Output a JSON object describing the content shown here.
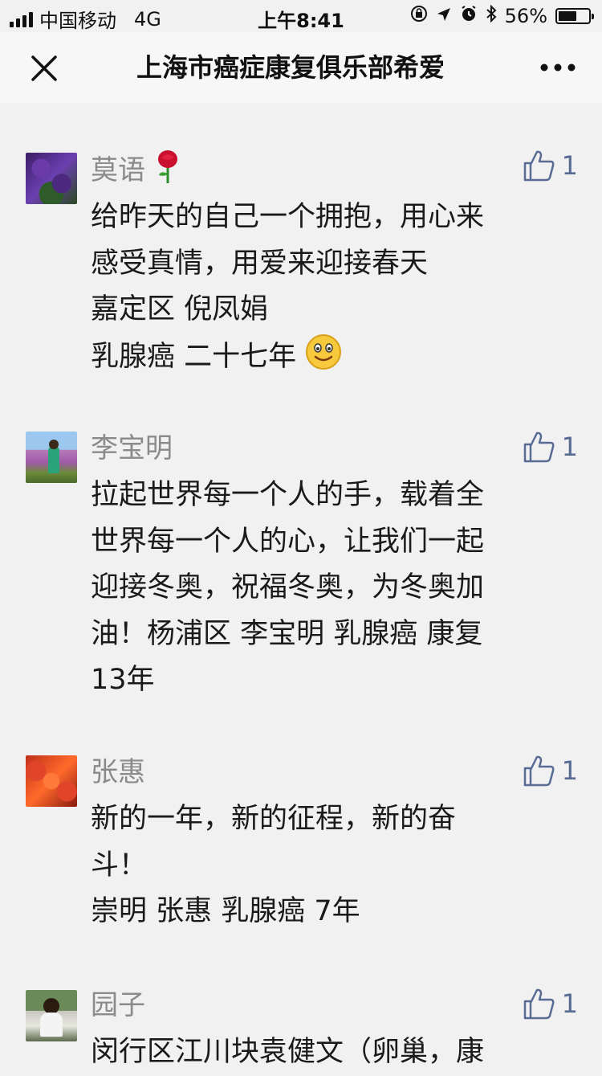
{
  "status_bar": {
    "carrier": "中国移动",
    "network": "4G",
    "time": "上午8:41",
    "battery": "56%",
    "battery_level": 0.56
  },
  "navbar": {
    "title": "上海市癌症康复俱乐部希爱",
    "close_icon": "close-icon",
    "more_icon": "more-dots-icon"
  },
  "comments": [
    {
      "name": "莫语",
      "likes": "1",
      "lines": [
        "给昨天的自己一个拥抱，用心来",
        "感受真情，用爱来迎接春天",
        "嘉定区  倪凤娟",
        "乳腺癌  二十七年"
      ]
    },
    {
      "name": "李宝明",
      "likes": "1",
      "lines": [
        "拉起世界每一个人的手，载着全",
        "世界每一个人的心，让我们一起",
        "迎接冬奥，祝福冬奥，为冬奥加",
        "油！杨浦区 李宝明 乳腺癌 康复",
        "13年"
      ]
    },
    {
      "name": "张惠",
      "likes": "1",
      "lines": [
        "新的一年，新的征程，新的奋",
        "斗！",
        "崇明 张惠  乳腺癌  7年"
      ]
    },
    {
      "name": "园子",
      "likes": "1",
      "lines": [
        "闵行区江川块袁健文（卵巢，康"
      ]
    }
  ],
  "colors": {
    "background": "#f1f1f1",
    "link_blue": "#586b95",
    "name_gray": "#8a8a8a"
  }
}
